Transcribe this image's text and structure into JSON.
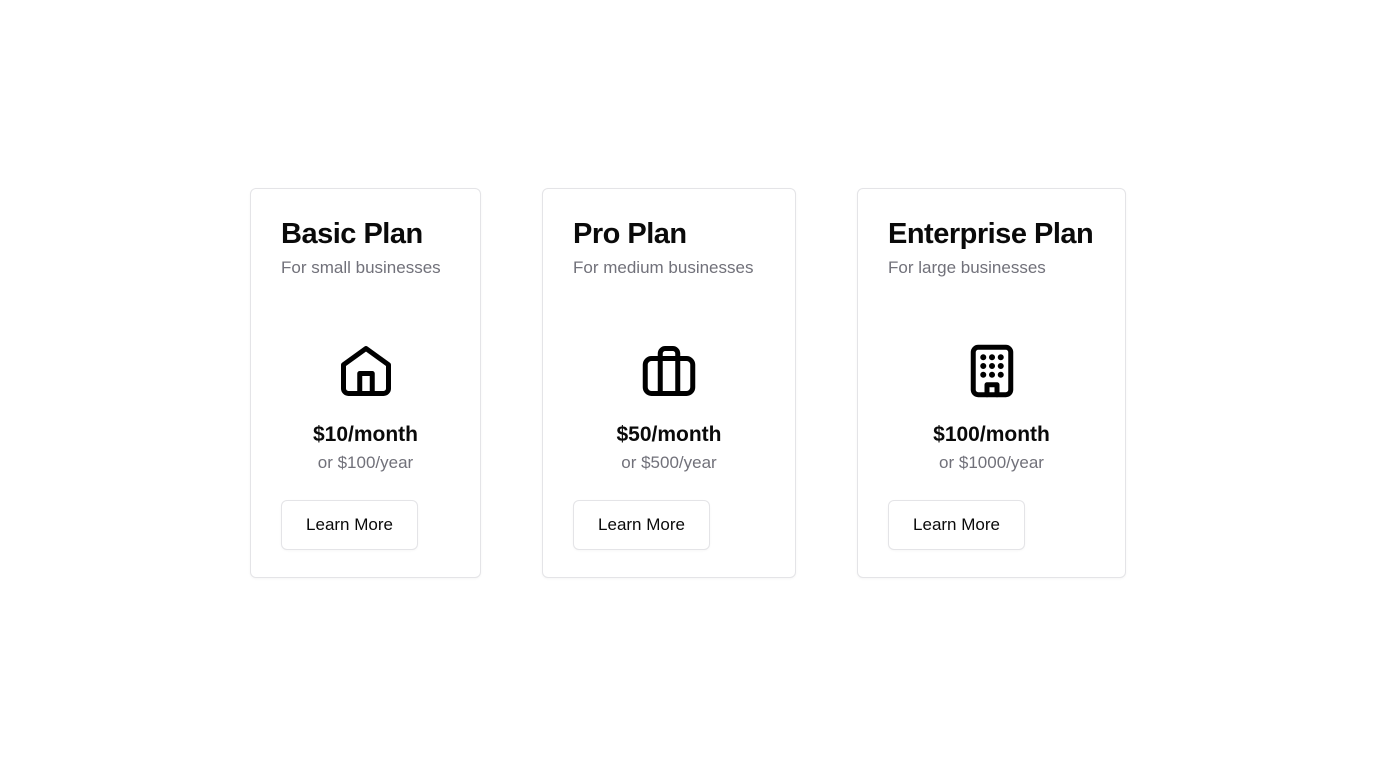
{
  "plans": [
    {
      "title": "Basic Plan",
      "description": "For small businesses",
      "icon": "home-icon",
      "price_month": "$10/month",
      "price_year": "or $100/year",
      "button_label": "Learn More"
    },
    {
      "title": "Pro Plan",
      "description": "For medium businesses",
      "icon": "briefcase-icon",
      "price_month": "$50/month",
      "price_year": "or $500/year",
      "button_label": "Learn More"
    },
    {
      "title": "Enterprise Plan",
      "description": "For large businesses",
      "icon": "building-icon",
      "price_month": "$100/month",
      "price_year": "or $1000/year",
      "button_label": "Learn More"
    }
  ],
  "colors": {
    "text": "#0a0a0a",
    "muted": "#71717a",
    "border": "#e4e4e7",
    "background": "#ffffff"
  }
}
